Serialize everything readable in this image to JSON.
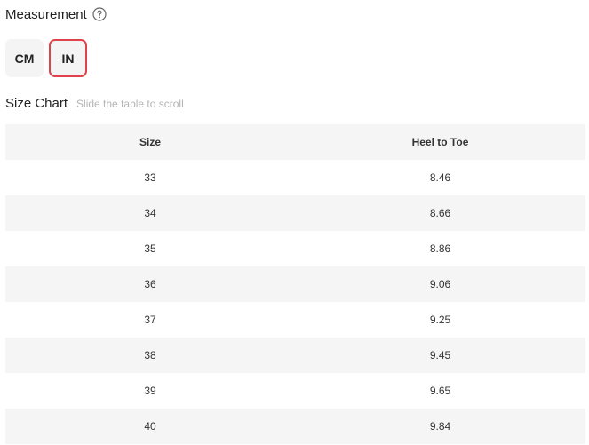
{
  "measurement": {
    "title": "Measurement",
    "help_icon": "question-circle-icon"
  },
  "units": [
    {
      "label": "CM",
      "selected": false
    },
    {
      "label": "IN",
      "selected": true
    }
  ],
  "accent_color": "#e0424b",
  "size_chart": {
    "title": "Size Chart",
    "hint": "Slide the table to scroll",
    "columns": [
      "Size",
      "Heel to Toe"
    ],
    "rows": [
      [
        "33",
        "8.46"
      ],
      [
        "34",
        "8.66"
      ],
      [
        "35",
        "8.86"
      ],
      [
        "36",
        "9.06"
      ],
      [
        "37",
        "9.25"
      ],
      [
        "38",
        "9.45"
      ],
      [
        "39",
        "9.65"
      ],
      [
        "40",
        "9.84"
      ]
    ]
  }
}
